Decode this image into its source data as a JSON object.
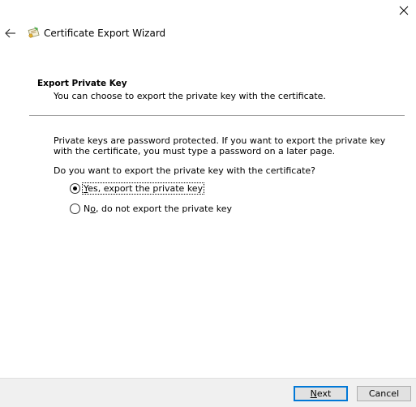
{
  "window": {
    "title": "Certificate Export Wizard",
    "close_label": "✕",
    "back_label": "←"
  },
  "section": {
    "heading": "Export Private Key",
    "subtitle": "You can choose to export the private key with the certificate."
  },
  "body": {
    "info": "Private keys are password protected. If you want to export the private key with the certificate, you must type a password on a later page.",
    "question": "Do you want to export the private key with the certificate?"
  },
  "options": [
    {
      "label_prefix": "",
      "accel": "Y",
      "label_rest": "es, export the private key",
      "selected": true
    },
    {
      "label_prefix": "N",
      "accel": "o",
      "label_rest": ", do not export the private key",
      "selected": false
    }
  ],
  "buttons": {
    "next_accel": "N",
    "next_rest": "ext",
    "cancel": "Cancel"
  }
}
